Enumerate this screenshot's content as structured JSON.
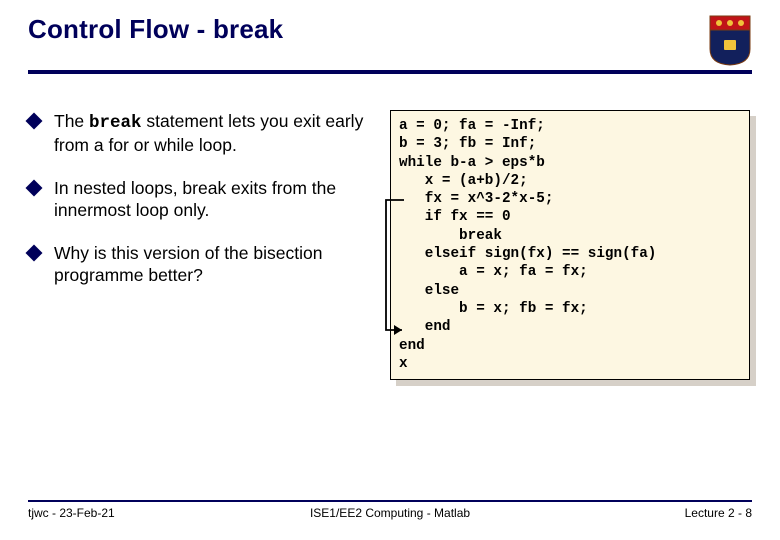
{
  "header": {
    "title": "Control Flow - break"
  },
  "bullets": {
    "b1_pre": "The ",
    "b1_code": "break",
    "b1_post": " statement lets you exit early from a for or while loop.",
    "b2": "In nested loops, break exits from the innermost loop only.",
    "b3": "Why is this version of the bisection programme better?"
  },
  "code": {
    "text": "a = 0; fa = -Inf;\nb = 3; fb = Inf;\nwhile b-a > eps*b\n   x = (a+b)/2;\n   fx = x^3-2*x-5;\n   if fx == 0\n       break\n   elseif sign(fx) == sign(fa)\n       a = x; fa = fx;\n   else\n       b = x; fb = fx;\n   end\nend\nx"
  },
  "footer": {
    "left": "tjwc - 23-Feb-21",
    "mid": "ISE1/EE2 Computing - Matlab",
    "right": "Lecture 2 - 8"
  }
}
